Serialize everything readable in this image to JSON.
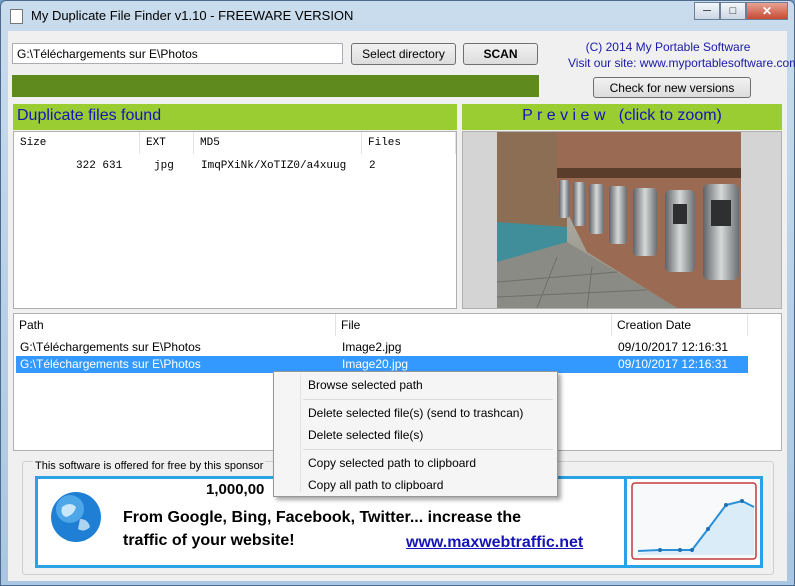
{
  "window": {
    "title": "My Duplicate File Finder v1.10 - FREEWARE VERSION"
  },
  "toolbar": {
    "path_value": "G:\\Téléchargements sur E\\Photos",
    "select_directory": "Select directory",
    "scan": "SCAN",
    "check_versions": "Check for new versions",
    "copyright_line1": "(C) 2014 My Portable Software",
    "copyright_line2": "Visit our site: www.myportablesoftware.com"
  },
  "duplicates": {
    "heading": "Duplicate files found",
    "columns": {
      "size": "Size",
      "ext": "EXT",
      "md5": "MD5",
      "files": "Files"
    },
    "rows": [
      {
        "size": "322 631",
        "ext": "jpg",
        "md5": "ImqPXiNk/XoTIZ0/a4xuug",
        "files": "2"
      }
    ]
  },
  "preview": {
    "heading": "P r e v i e w   (click to zoom)"
  },
  "files": {
    "columns": {
      "path": "Path",
      "file": "File",
      "created": "Creation Date"
    },
    "rows": [
      {
        "path": "G:\\Téléchargements sur E\\Photos",
        "file": "Image2.jpg",
        "created": "09/10/2017 12:16:31"
      },
      {
        "path": "G:\\Téléchargements sur E\\Photos",
        "file": "Image20.jpg",
        "created": "09/10/2017 12:16:31"
      }
    ]
  },
  "context_menu": {
    "browse": "Browse selected path",
    "delete_trash": "Delete selected file(s) (send to trashcan)",
    "delete": "Delete selected file(s)",
    "copy_selected": "Copy selected path to clipboard",
    "copy_all": "Copy all path to clipboard"
  },
  "sponsor": {
    "label": "This software is offered for free by this sponsor",
    "headline_partial": "1,000,00",
    "line1": "From Google, Bing, Facebook, Twitter... increase the",
    "line2": "traffic of your website!",
    "url": "www.maxwebtraffic.net"
  },
  "colors": {
    "accent_green": "#9acd32",
    "progress_green": "#5e8a1e",
    "selection_blue": "#3399ff",
    "banner_blue": "#29a3e6",
    "heading_blue": "#1414b8"
  }
}
